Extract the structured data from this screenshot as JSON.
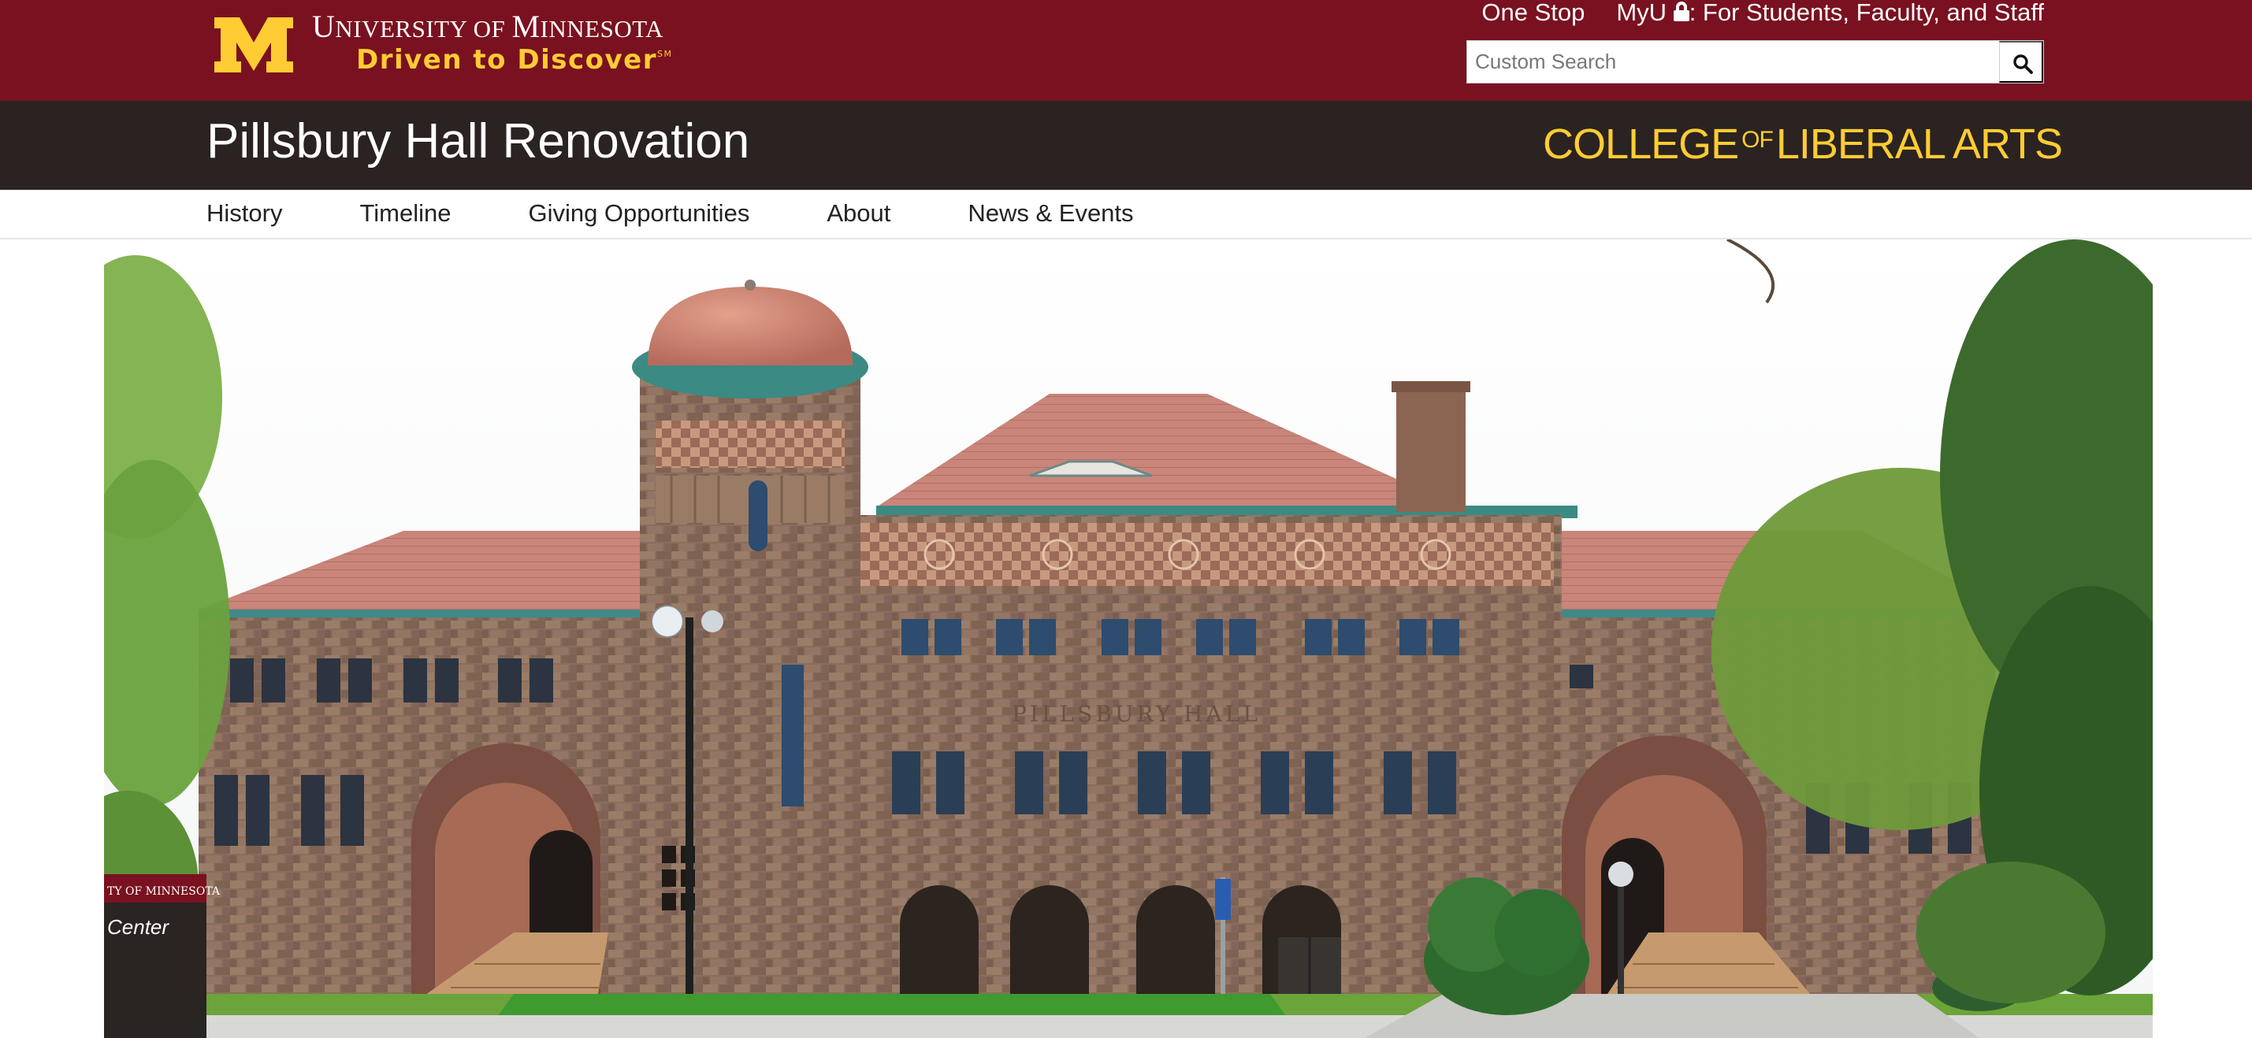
{
  "header": {
    "university_name_cap1": "U",
    "university_name_rest1": "NIVERSITY OF ",
    "university_name_cap2": "M",
    "university_name_rest2": "INNESOTA",
    "tagline": "Driven to Discover",
    "tagline_mark": "SM",
    "links": {
      "one_stop": "One Stop",
      "myu": "MyU",
      "myu_suffix": ": For Students, Faculty, and Staff"
    },
    "search": {
      "placeholder": "Custom Search",
      "value": ""
    }
  },
  "site": {
    "title": "Pillsbury Hall Renovation",
    "college_part1": "COLLEGE",
    "college_of": "OF",
    "college_part2": "LIBERAL ARTS"
  },
  "nav": {
    "items": [
      {
        "label": "History"
      },
      {
        "label": "Timeline"
      },
      {
        "label": "Giving Opportunities"
      },
      {
        "label": "About"
      },
      {
        "label": "News & Events"
      }
    ]
  },
  "hero": {
    "building_inscription": "PILLSBURY HALL",
    "sign_text_1": "TY OF MINNESOTA",
    "sign_text_2": "Center"
  },
  "colors": {
    "maroon": "#7a1120",
    "gold": "#ffcc33",
    "dark_header": "#2a2322",
    "nav_text": "#222222"
  },
  "icons": [
    "umn-m-logo",
    "lock-icon",
    "search-icon"
  ]
}
